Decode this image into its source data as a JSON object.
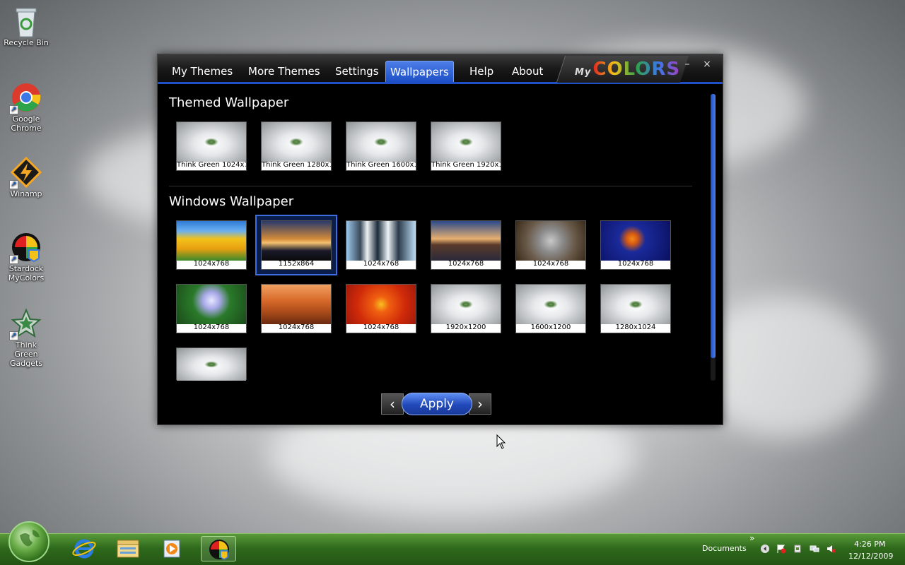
{
  "desktop": {
    "icons": [
      {
        "label": "Recycle Bin"
      },
      {
        "label": "Google Chrome"
      },
      {
        "label": "Winamp"
      },
      {
        "label": "Stardock MyColors"
      },
      {
        "label": "Think Green Gadgets"
      }
    ]
  },
  "window": {
    "tabs": [
      "My Themes",
      "More Themes",
      "Settings",
      "Wallpapers",
      "Help",
      "About"
    ],
    "active_tab": "Wallpapers",
    "logo": {
      "prefix": "My",
      "text": "COLORS"
    },
    "controls": {
      "minimize": "–",
      "close": "×"
    },
    "themed_title": "Themed Wallpaper",
    "themed": [
      "Think Green 1024x7",
      "Think Green 1280x1",
      "Think Green 1600x1",
      "Think Green 1920x1"
    ],
    "windows_title": "Windows Wallpaper",
    "windows": [
      "1024x768",
      "1152x864",
      "1024x768",
      "1024x768",
      "1024x768",
      "1024x768",
      "1024x768",
      "1024x768",
      "1024x768",
      "1920x1200",
      "1600x1200",
      "1280x1024",
      ""
    ],
    "selected_index": 1,
    "prev": "‹",
    "next": "›",
    "apply": "Apply"
  },
  "taskbar": {
    "toolbar_label": "Documents",
    "chevron": "»",
    "time": "4:26 PM",
    "date": "12/12/2009"
  }
}
